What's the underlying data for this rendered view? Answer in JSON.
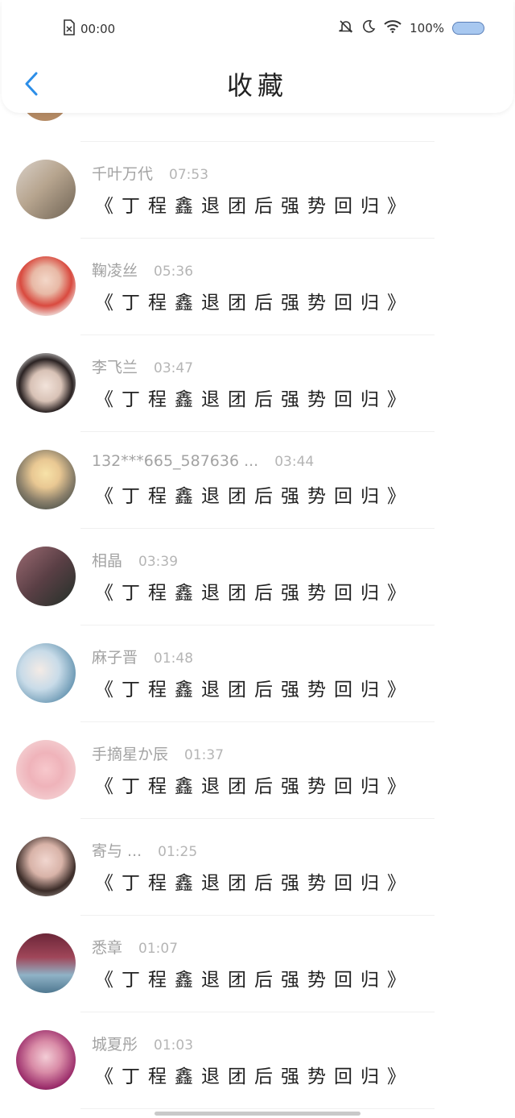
{
  "status_bar": {
    "time": "00:00",
    "battery": "100%"
  },
  "header": {
    "title": "收藏"
  },
  "items": [
    {
      "name": "千叶万代",
      "time": "07:53",
      "message": "《丁程鑫退团后强势回归》",
      "avatar_bg": "linear-gradient(135deg,#d9d0c8 0%,#b7a58f 45%,#6f6354 100%)"
    },
    {
      "name": "鞠凌丝",
      "time": "05:36",
      "message": "《丁程鑫退团后强势回归》",
      "avatar_bg": "radial-gradient(circle at 50% 40%,#f3d7c8 0%,#e8b9a6 30%,#d94a3f 55%,#f1e9e6 80%)"
    },
    {
      "name": "李飞兰",
      "time": "03:47",
      "message": "《丁程鑫退团后强势回归》",
      "avatar_bg": "radial-gradient(circle at 50% 55%,#f2e3da 0%,#d8c2b6 35%,#2a2222 60%,#efefef 85%)"
    },
    {
      "name": "132***665_587636 ...",
      "time": "03:44",
      "message": "《丁程鑫退团后强势回归》",
      "avatar_bg": "radial-gradient(circle at 50% 40%,#f7e2a8 0%,#e9c893 30%,#8a7f6a 60%,#2c3a3a 100%)"
    },
    {
      "name": "相晶",
      "time": "03:39",
      "message": "《丁程鑫退团后强势回归》",
      "avatar_bg": "linear-gradient(135deg,#9b6a72 0%,#5a3f45 50%,#223028 100%)"
    },
    {
      "name": "麻子晋",
      "time": "01:48",
      "message": "《丁程鑫退团后强势回归》",
      "avatar_bg": "radial-gradient(circle at 40% 45%,#f4ebe6 0%,#c8dbe8 40%,#6d9ab5 75%,#2f5c7a 100%)"
    },
    {
      "name": "手摘星か辰",
      "time": "01:37",
      "message": "《丁程鑫退团后强势回归》",
      "avatar_bg": "radial-gradient(circle at 50% 50%,#f7c8cc 0%,#efb3ba 40%,#f6dede 100%)"
    },
    {
      "name": "寄与 ...",
      "time": "01:25",
      "message": "《丁程鑫退团后强势回归》",
      "avatar_bg": "radial-gradient(circle at 50% 40%,#f1d6cf 0%,#d8b3a8 35%,#3b2c28 65%,#c0b8b3 100%)"
    },
    {
      "name": "悉章",
      "time": "01:07",
      "message": "《丁程鑫退团后强势回归》",
      "avatar_bg": "linear-gradient(180deg,#6b2638 0%,#a04659 40%,#8fb2c6 70%,#4f7890 100%)"
    },
    {
      "name": "城夏彤",
      "time": "01:03",
      "message": "《丁程鑫退团后强势回归》",
      "avatar_bg": "radial-gradient(circle at 50% 45%,#f3cdd6 0%,#d98ca7 35%,#9b2d6b 70%,#3a1430 100%)"
    }
  ]
}
